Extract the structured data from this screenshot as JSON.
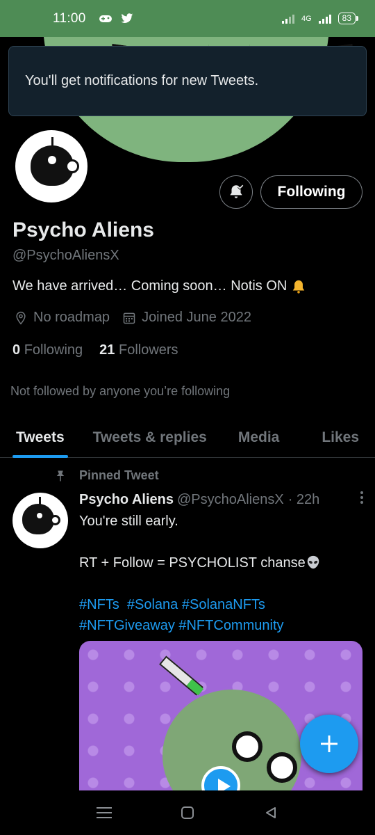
{
  "status_bar": {
    "time": "11:00",
    "network": "4G",
    "battery": "83"
  },
  "toast": {
    "message": "You'll get notifications for new Tweets."
  },
  "profile": {
    "follow_button": "Following",
    "name": "Psycho Aliens",
    "handle": "@PsychoAliensX",
    "bio": "We have arrived… Coming soon… Notis ON",
    "location": "No roadmap",
    "joined": "Joined June 2022",
    "following_count": "0",
    "following_label": "Following",
    "followers_count": "21",
    "followers_label": "Followers",
    "not_followed": "Not followed by anyone you’re following"
  },
  "tabs": [
    {
      "label": "Tweets",
      "active": true
    },
    {
      "label": "Tweets & replies",
      "active": false
    },
    {
      "label": "Media",
      "active": false
    },
    {
      "label": "Likes",
      "active": false
    }
  ],
  "tweet": {
    "pinned_label": "Pinned Tweet",
    "author_name": "Psycho Aliens",
    "author_handle": "@PsychoAliensX",
    "age": "· 22h",
    "line1": "You're still early.",
    "line2": "",
    "line3": "RT + Follow = PSYCHOLIST chanse",
    "line4": "",
    "hashtags_line1": "#NFTs  #Solana #SolanaNFTs",
    "hashtags_line2": "#NFTGiveaway #NFTCommunity"
  },
  "colors": {
    "accent": "#1d9bf0",
    "status_bar": "#4e8c55",
    "background": "#000000",
    "muted_text": "#71767b"
  },
  "icons": {
    "location": "location-pin-icon",
    "calendar": "calendar-icon",
    "bell": "bell-check-icon",
    "pin": "pin-icon",
    "more": "more-vertical-icon",
    "compose": "plus-icon"
  }
}
